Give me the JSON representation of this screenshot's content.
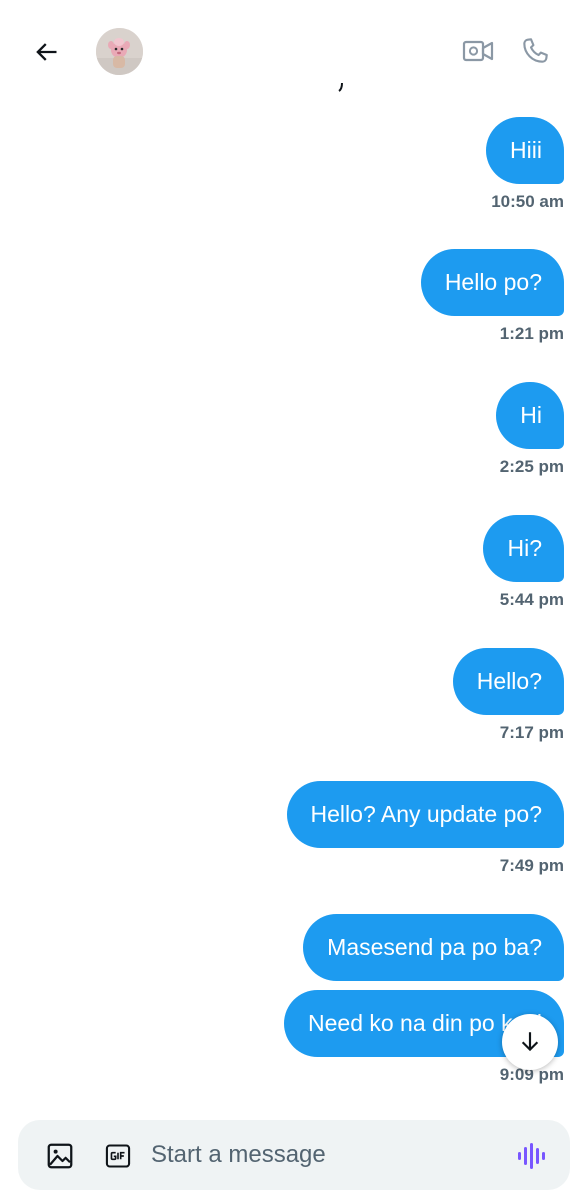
{
  "composer": {
    "placeholder": "Start a message"
  },
  "messages": [
    {
      "text": "Hiii",
      "time": "10:50 am"
    },
    {
      "text": "Hello po?",
      "time": "1:21 pm"
    },
    {
      "text": "Hi",
      "time": "2:25 pm"
    },
    {
      "text": "Hi?",
      "time": "5:44 pm"
    },
    {
      "text": "Hello?",
      "time": "7:17 pm"
    },
    {
      "text": "Hello? Any update po?",
      "time": "7:49 pm"
    },
    {
      "text": "Masesend pa po ba?",
      "time": ""
    },
    {
      "text": "Need ko na din po kasi",
      "time": "9:09 pm"
    }
  ],
  "icons": {
    "back": "arrow-left-icon",
    "video": "video-camera-icon",
    "call": "phone-icon",
    "image": "image-icon",
    "gif": "gif-icon",
    "voice": "voice-wave-icon",
    "scroll": "arrow-down-icon"
  },
  "colors": {
    "bubble": "#1d9bf0",
    "timestamp": "#536471",
    "composer_bg": "#eff3f4",
    "voice_accent": "#7856ff",
    "header_icons_muted": "#536471"
  }
}
